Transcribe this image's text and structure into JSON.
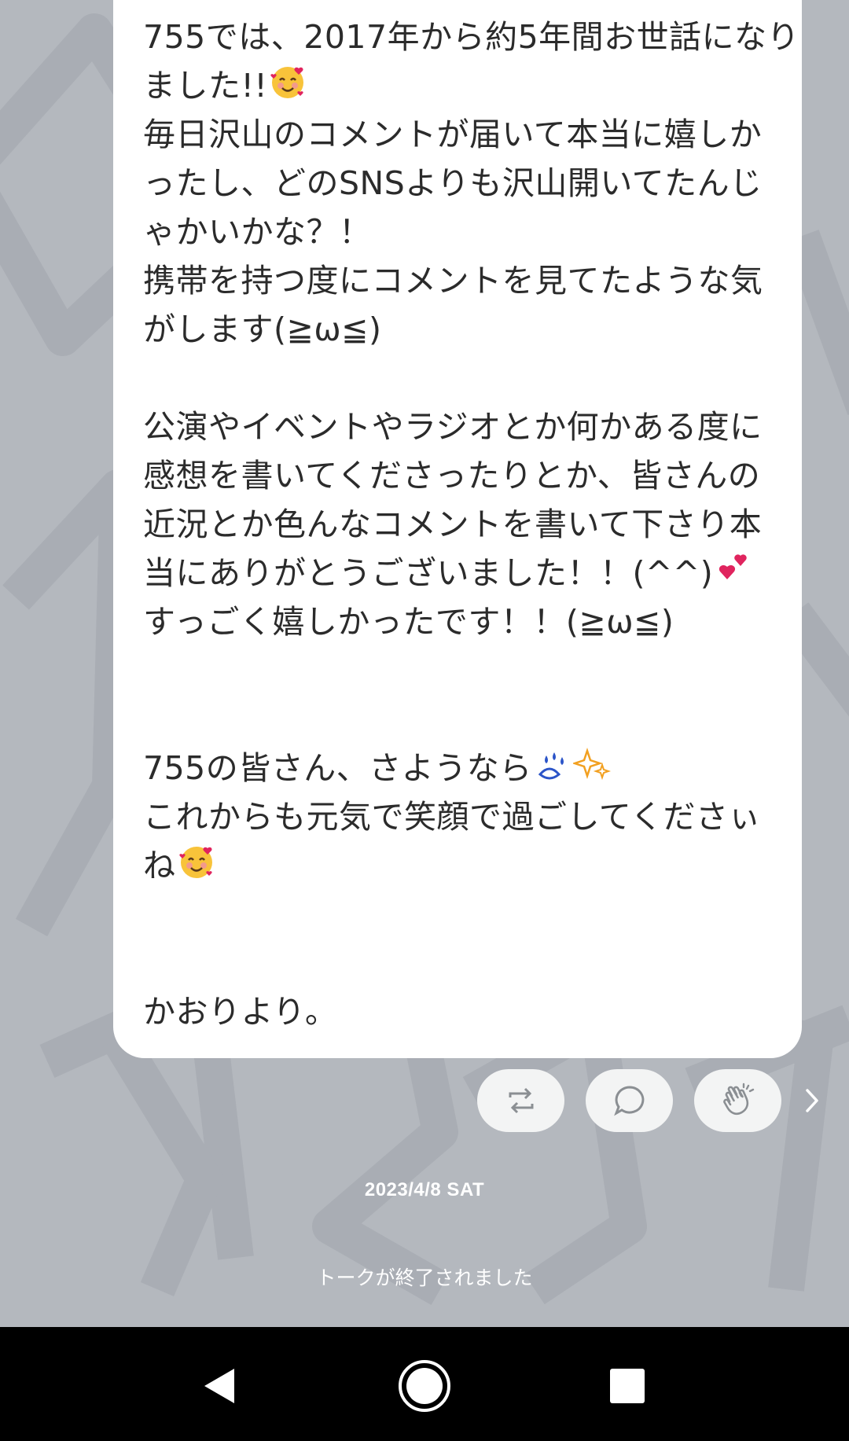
{
  "post": {
    "lines": [
      "755では、2017年から約5年間お世話になり",
      "ました!!",
      "毎日沢山のコメントが届いて本当に嬉しか",
      "ったし、どのSNSよりも沢山開いてたんじ",
      "ゃかいかな？！",
      "携帯を持つ度にコメントを見てたような気",
      "がします(≧ω≦)",
      "",
      "公演やイベントやラジオとか何かある度に",
      "感想を書いてくださったりとか、皆さんの",
      "近況とか色んなコメントを書いて下さり本",
      "当にありがとうございました！！(^^)",
      "すっごく嬉しかったです！！(≧ω≦)",
      "",
      "",
      "755の皆さん、さようなら",
      "これからも元気で笑顔で過ごしてくださぃ",
      "ね",
      "",
      "",
      "かおりより。"
    ],
    "emojis": {
      "line1": "smiling-face-with-hearts",
      "line11": "two-hearts",
      "line15a": "sweat-droplets",
      "line15b": "sparkles",
      "line17": "smiling-face-with-hearts"
    }
  },
  "actions": {
    "repost": "repost-icon",
    "comment": "comment-icon",
    "clap": "clap-icon",
    "more": "chevron-right-icon"
  },
  "date": "2023/4/8 SAT",
  "status": "トークが終了されました",
  "colors": {
    "background": "#b4b8be",
    "bubble": "#ffffff",
    "text": "#2b2b2b",
    "pill": "#f3f4f4",
    "navbar": "#000000"
  }
}
